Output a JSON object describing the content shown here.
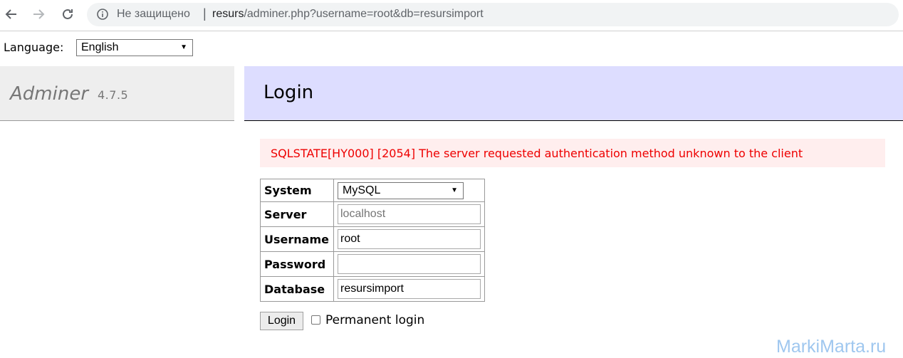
{
  "browser": {
    "security_text": "Не защищено",
    "separator": "|",
    "url_host": "resurs",
    "url_path": "/adminer.php?username=root&db=resursimport"
  },
  "language": {
    "label": "Language:",
    "selected": "English"
  },
  "brand": {
    "name": "Adminer",
    "version": "4.7.5"
  },
  "page": {
    "title": "Login"
  },
  "error": {
    "message": "SQLSTATE[HY000] [2054] The server requested authentication method unknown to the client"
  },
  "form": {
    "system": {
      "label": "System",
      "selected": "MySQL"
    },
    "server": {
      "label": "Server",
      "placeholder": "localhost",
      "value": ""
    },
    "username": {
      "label": "Username",
      "value": "root"
    },
    "password": {
      "label": "Password",
      "value": ""
    },
    "database": {
      "label": "Database",
      "value": "resursimport"
    },
    "login_button": "Login",
    "permanent_login_label": "Permanent login",
    "permanent_login_checked": false
  },
  "watermark": "MarkiMarta.ru",
  "colors": {
    "header_bg": "#ddddff",
    "error_bg": "#ffeeee",
    "error_text": "#ee0000",
    "brand_panel_bg": "#eeeeee"
  }
}
